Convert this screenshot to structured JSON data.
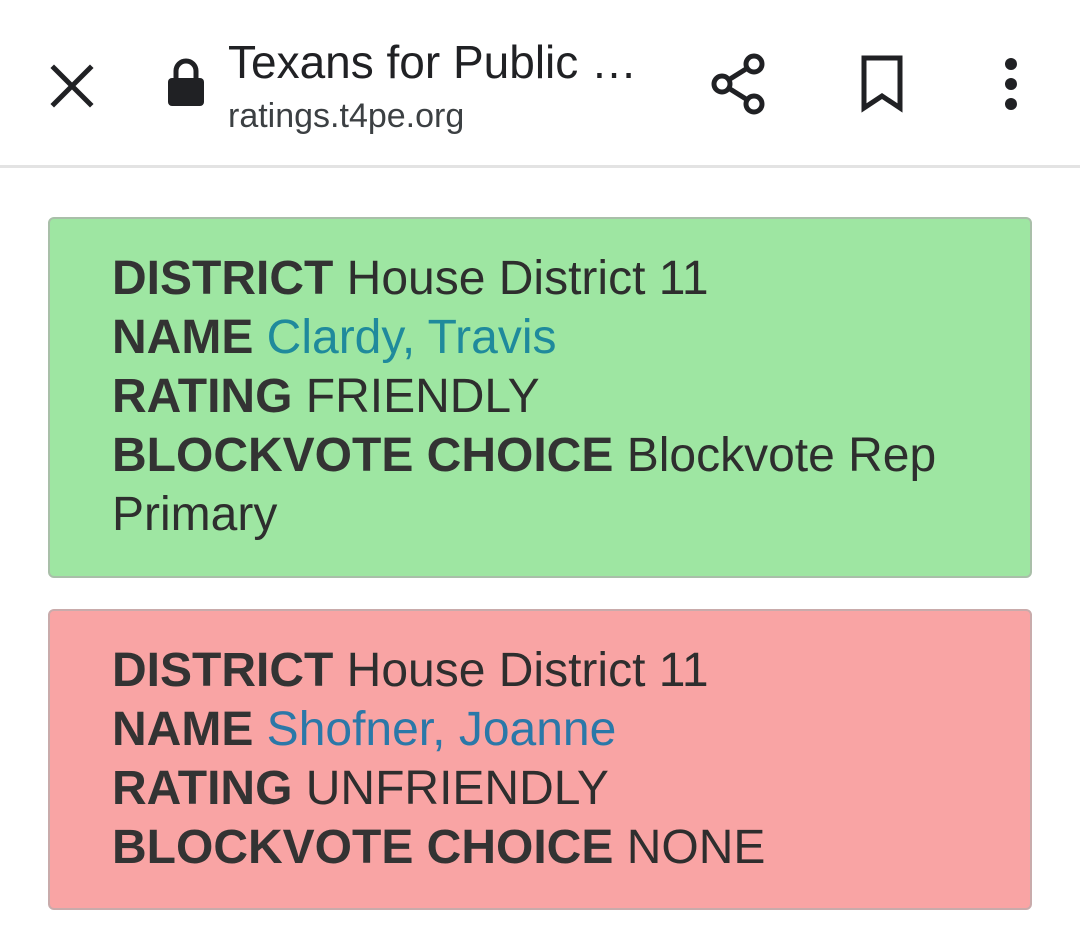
{
  "toolbar": {
    "title": "Texans for Public …",
    "url": "ratings.t4pe.org"
  },
  "cards": [
    {
      "district_label": "DISTRICT",
      "district": "House District 11",
      "name_label": "NAME",
      "name": "Clardy, Travis",
      "rating_label": "RATING",
      "rating": "FRIENDLY",
      "blockvote_label": "BLOCKVOTE CHOICE",
      "blockvote": "Blockvote Rep Primary",
      "background": "#9ee6a2",
      "link_color": "#1f8a9c"
    },
    {
      "district_label": "DISTRICT",
      "district": "House District 11",
      "name_label": "NAME",
      "name": "Shofner, Joanne",
      "rating_label": "RATING",
      "rating": "UNFRIENDLY",
      "blockvote_label": "BLOCKVOTE CHOICE",
      "blockvote": "NONE",
      "background": "#f9a4a4",
      "link_color": "#2b78a8"
    }
  ],
  "icons": {
    "close": "close-icon",
    "lock": "lock-icon",
    "share": "share-icon",
    "bookmark": "bookmark-icon",
    "menu": "more-vertical-icon"
  }
}
